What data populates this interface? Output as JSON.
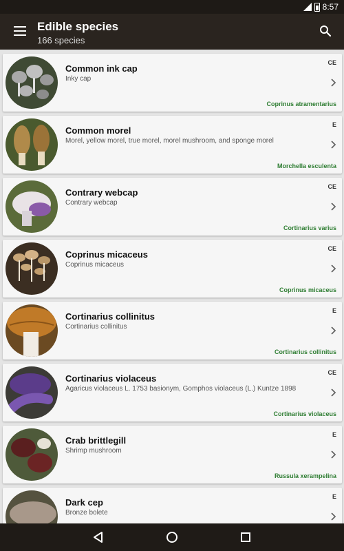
{
  "statusbar": {
    "time": "8:57"
  },
  "appbar": {
    "title": "Edible species",
    "subtitle": "166 species"
  },
  "icons": {
    "menu": "menu-icon",
    "search": "search-icon",
    "chevron": "chevron-right-icon",
    "back": "back-icon",
    "home": "home-icon",
    "recents": "recents-icon"
  },
  "colors": {
    "latin": "#2e7d32",
    "appbar": "#2a241f",
    "statusbar": "#1e1a16"
  },
  "species": [
    {
      "name": "Common ink cap",
      "aka": "Inky cap",
      "code": "CE",
      "latin": "Coprinus atramentarius"
    },
    {
      "name": "Common morel",
      "aka": "Morel, yellow morel, true morel, morel mushroom, and sponge morel",
      "code": "E",
      "latin": "Morchella esculenta"
    },
    {
      "name": "Contrary webcap",
      "aka": "Contrary webcap",
      "code": "CE",
      "latin": "Cortinarius varius"
    },
    {
      "name": "Coprinus micaceus",
      "aka": "Coprinus micaceus",
      "code": "CE",
      "latin": "Coprinus micaceus"
    },
    {
      "name": "Cortinarius collinitus",
      "aka": "Cortinarius collinitus",
      "code": "E",
      "latin": "Cortinarius collinitus"
    },
    {
      "name": "Cortinarius violaceus",
      "aka": "Agaricus violaceus L. 1753 basionym, Gomphos violaceus (L.) Kuntze 1898",
      "code": "CE",
      "latin": "Cortinarius violaceus"
    },
    {
      "name": "Crab brittlegill",
      "aka": "Shrimp mushroom",
      "code": "E",
      "latin": "Russula xerampelina"
    },
    {
      "name": "Dark cep",
      "aka": "Bronze bolete",
      "code": "E",
      "latin": ""
    }
  ]
}
